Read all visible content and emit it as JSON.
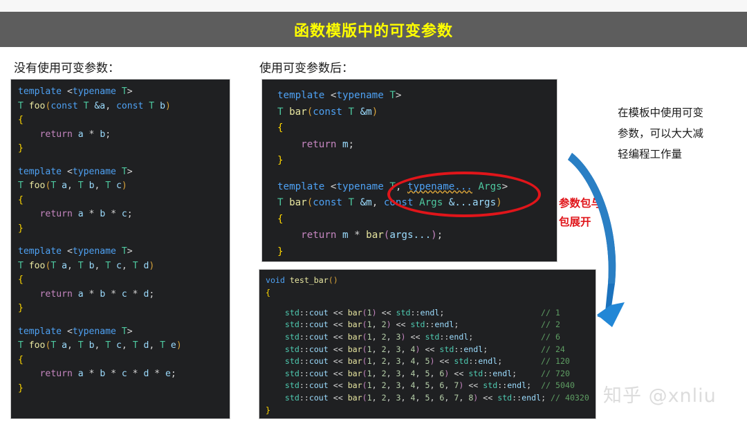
{
  "title": "函数模版中的可变参数",
  "colors": {
    "title_bar_bg": "#5d5d5d",
    "title_text": "#ffff00",
    "code_bg": "#1f2022",
    "annotation_red": "#e0151a",
    "arrow_blue": "#1b72bd",
    "watermark": "#dcdcdc"
  },
  "headings": {
    "left": "没有使用可变参数：",
    "right": "使用可变参数后："
  },
  "left_code": {
    "lines": [
      "template <typename T>",
      "T foo(const T &a, const T b)",
      "{",
      "    return a * b;",
      "}",
      "",
      "template <typename T>",
      "T foo(T a, T b, T c)",
      "{",
      "    return a * b * c;",
      "}",
      "",
      "template <typename T>",
      "T foo(T a, T b, T c, T d)",
      "{",
      "    return a * b * c * d;",
      "}",
      "",
      "template <typename T>",
      "T foo(T a, T b, T c, T d, T e)",
      "{",
      "    return a * b * c * d * e;",
      "}"
    ]
  },
  "right_top_code": {
    "lines": [
      "template <typename T>",
      "T bar(const T &m)",
      "{",
      "    return m;",
      "}",
      "",
      "template <typename T, typename... Args>",
      "T bar(const T &m, const Args &...args)",
      "{",
      "    return m * bar(args...);",
      "}"
    ]
  },
  "right_bottom_code": {
    "lines": [
      "void test_bar()",
      "{",
      "",
      "    std::cout << bar(1) << std::endl;                    // 1",
      "    std::cout << bar(1, 2) << std::endl;                 // 2",
      "    std::cout << bar(1, 2, 3) << std::endl;              // 6",
      "    std::cout << bar(1, 2, 3, 4) << std::endl;           // 24",
      "    std::cout << bar(1, 2, 3, 4, 5) << std::endl;        // 120",
      "    std::cout << bar(1, 2, 3, 4, 5, 6) << std::endl;     // 720",
      "    std::cout << bar(1, 2, 3, 4, 5, 6, 7) << std::endl;  // 5040",
      "    std::cout << bar(1, 2, 3, 4, 5, 6, 7, 8) << std::endl; // 40320",
      "}"
    ],
    "comment_values": [
      "1",
      "2",
      "6",
      "24",
      "120",
      "720",
      "5040",
      "40320"
    ]
  },
  "annotations": {
    "note_right_lines": [
      "在模板中使用可变",
      "参数，可以大大减",
      "轻编程工作量"
    ],
    "note_red_lines": [
      "参数包与",
      "包展开"
    ],
    "highlight_target": "typename T, typename... Args> / const T &m, const Args &...args)"
  },
  "watermark": "知乎 @xnliu"
}
